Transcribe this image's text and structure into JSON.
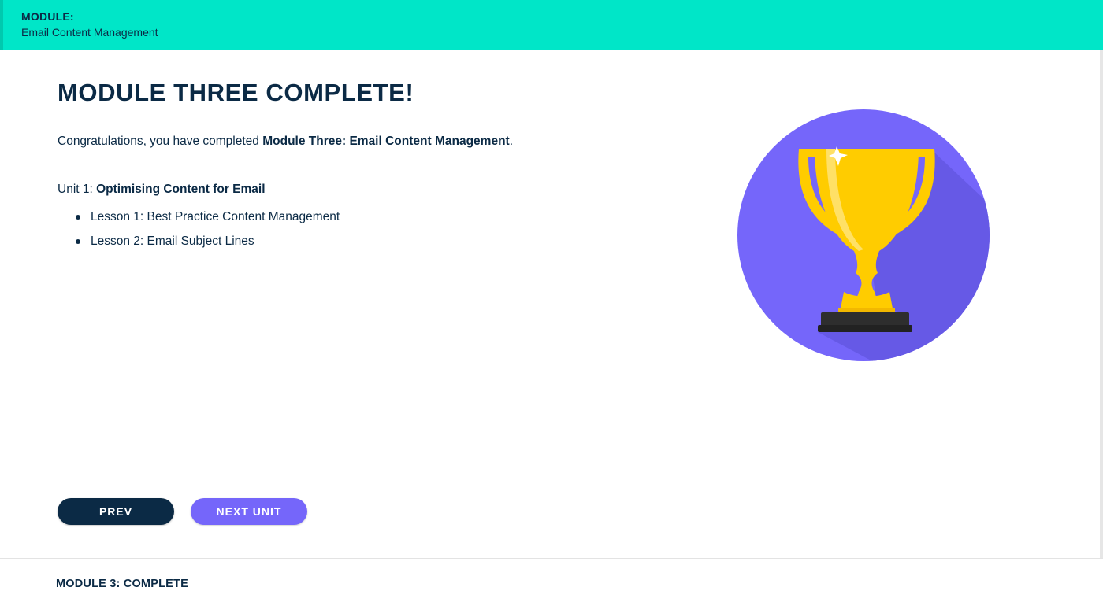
{
  "header": {
    "module_label": "MODULE:",
    "module_name": "Email Content Management"
  },
  "main": {
    "title": "MODULE THREE COMPLETE!",
    "congrats_prefix": "Congratulations, you have completed ",
    "congrats_bold": "Module Three: Email Content Management",
    "congrats_suffix": ".",
    "unit_prefix": "Unit 1: ",
    "unit_name": "Optimising Content for Email",
    "lessons": [
      {
        "label": "Lesson 1: Best Practice Content Management"
      },
      {
        "label": "Lesson 2: Email Subject Lines"
      }
    ],
    "image_icon": "trophy-icon"
  },
  "buttons": {
    "prev_label": "PREV",
    "next_label": "NEXT UNIT"
  },
  "footer": {
    "status": "MODULE 3: COMPLETE"
  },
  "colors": {
    "header_bg": "#00e6c8",
    "text_primary": "#0b2a45",
    "accent_purple": "#7566fa",
    "trophy_gold": "#ffcc00",
    "prev_button": "#0b2a45"
  }
}
